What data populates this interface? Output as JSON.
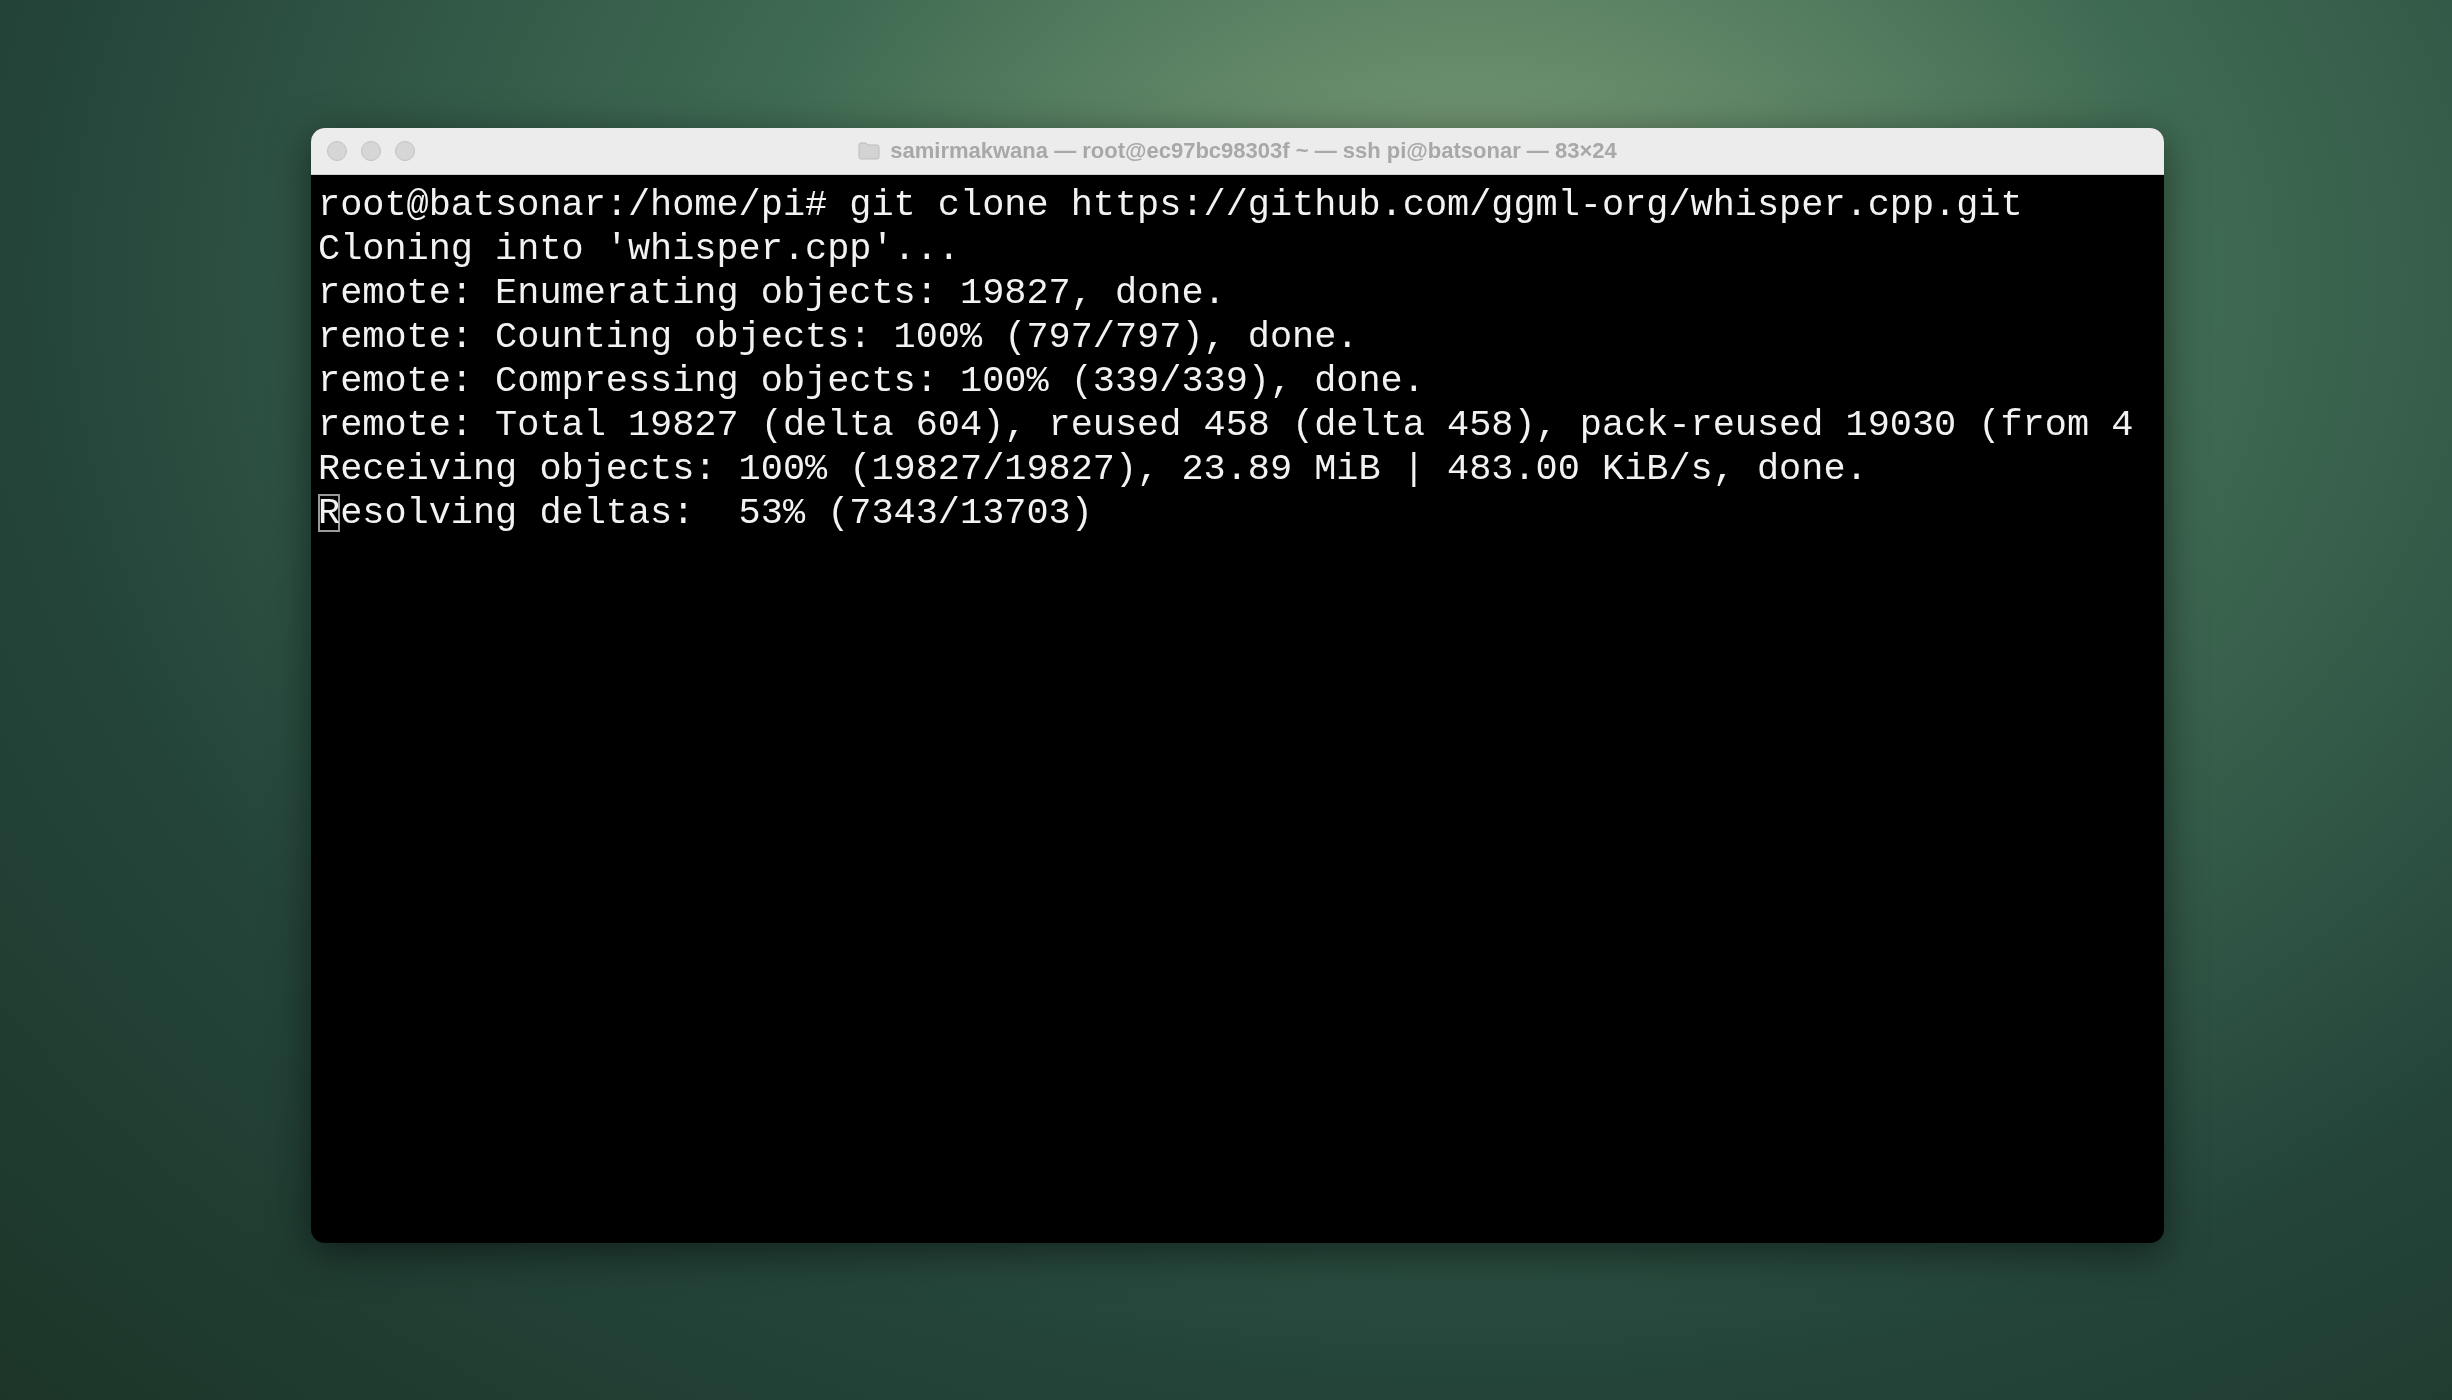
{
  "window": {
    "title": "samirmakwana — root@ec97bc98303f ~ — ssh pi@batsonar — 83×24"
  },
  "terminal": {
    "lines": [
      "root@batsonar:/home/pi# git clone https://github.com/ggml-org/whisper.cpp.git",
      "Cloning into 'whisper.cpp'...",
      "remote: Enumerating objects: 19827, done.",
      "remote: Counting objects: 100% (797/797), done.",
      "remote: Compressing objects: 100% (339/339), done.",
      "remote: Total 19827 (delta 604), reused 458 (delta 458), pack-reused 19030 (from 4",
      "Receiving objects: 100% (19827/19827), 23.89 MiB | 483.00 KiB/s, done.",
      "Resolving deltas:  53% (7343/13703)"
    ]
  }
}
